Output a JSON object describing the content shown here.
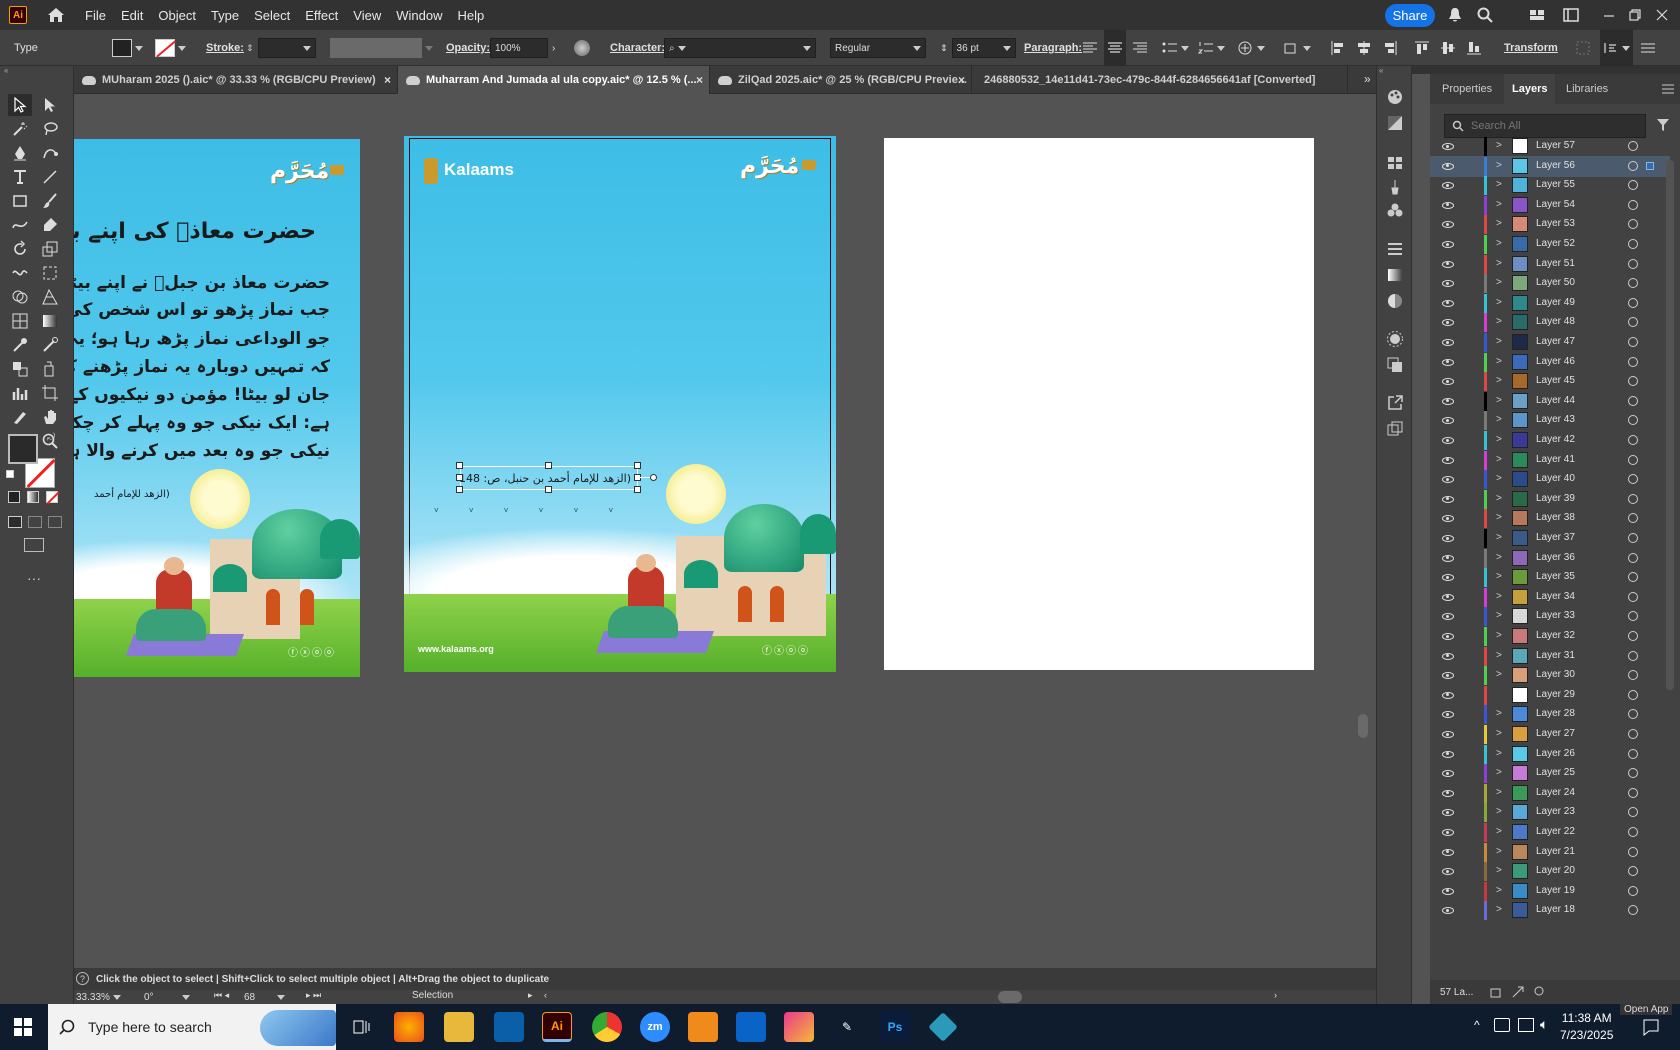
{
  "app": {
    "logo": "Ai",
    "menu": [
      "File",
      "Edit",
      "Object",
      "Type",
      "Select",
      "Effect",
      "View",
      "Window",
      "Help"
    ],
    "share": "Share"
  },
  "control": {
    "type_label": "Type",
    "stroke_label": "Stroke:",
    "opacity_label": "Opacity:",
    "opacity_value": "100%",
    "character_label": "Character:",
    "font_style": "Regular",
    "font_size": "36 pt",
    "paragraph_label": "Paragraph:",
    "transform_label": "Transform"
  },
  "tabs": [
    {
      "label": "MUharam 2025 ().aic* @ 33.33 % (RGB/CPU Preview)",
      "close": "×"
    },
    {
      "label": "Muharram And Jumada al ula copy.aic* @ 12.5 % (...",
      "close": "×"
    },
    {
      "label": "ZilQad 2025.aic* @ 25 % (RGB/CPU Previe...",
      "close": "×"
    },
    {
      "label": "246880532_14e11d41-73ec-479c-844f-6284656641af [Converted]",
      "close": ""
    }
  ],
  "artboard1": {
    "logo_urdu": "مُحَرَّم",
    "heading": "حضرت معاذؓ کی اپنے بیٹے کو",
    "body": [
      "حضرت معاذ بن جبلؓ نے اپنے بیٹے سے",
      "جب نماز پڑھو تو اس شخص کی طرح",
      "جو الوداعی نماز پڑھ رہا ہو؛ یہ ہرگز",
      "کہ تمہیں دوبارہ یہ نماز پڑھنے کا موقع",
      "جان لو بیٹا! مؤمن دو نیکیوں کے درمیان",
      "ہے: ایک نیکی جو وہ پہلے کر چکا ہے",
      "نیکی جو وہ بعد میں کرنے والا ہے"
    ],
    "reference": "(الزھد للإمام أحمد"
  },
  "artboard2": {
    "brand": "Kalaams",
    "logo_urdu": "مُحَرَّم",
    "selected_text": "(الزھد للإمام أحمد بن حنبل، ص: 148",
    "website": "www.kalaams.org"
  },
  "panel": {
    "tabs": [
      "Properties",
      "Layers",
      "Libraries"
    ],
    "search_placeholder": "Search All",
    "layers": [
      {
        "name": "Layer 57",
        "color": "#000000",
        "thumb": "#ffffff"
      },
      {
        "name": "Layer 56",
        "color": "#3a7fd6",
        "thumb": "#5bc6e8",
        "selected": true
      },
      {
        "name": "Layer 55",
        "color": "#37c3d6",
        "thumb": "#4fb3da"
      },
      {
        "name": "Layer 54",
        "color": "#8f3fd8",
        "thumb": "#8a55c7"
      },
      {
        "name": "Layer 53",
        "color": "#e04646",
        "thumb": "#d88a7a"
      },
      {
        "name": "Layer 52",
        "color": "#4fd14f",
        "thumb": "#3b6aa8"
      },
      {
        "name": "Layer 51",
        "color": "#e04646",
        "thumb": "#6c8fc4"
      },
      {
        "name": "Layer 50",
        "color": "#7a7a7a",
        "thumb": "#7fa87a"
      },
      {
        "name": "Layer 49",
        "color": "#37c3d6",
        "thumb": "#2e8a8a"
      },
      {
        "name": "Layer 48",
        "color": "#d23fd2",
        "thumb": "#2b6a6a"
      },
      {
        "name": "Layer 47",
        "color": "#3a56d6",
        "thumb": "#1f2a4a"
      },
      {
        "name": "Layer 46",
        "color": "#4fd14f",
        "thumb": "#3a6ab8"
      },
      {
        "name": "Layer 45",
        "color": "#e04646",
        "thumb": "#a8682a"
      },
      {
        "name": "Layer 44",
        "color": "#000000",
        "thumb": "#6aa0c8"
      },
      {
        "name": "Layer 43",
        "color": "#7a7a7a",
        "thumb": "#5a96c8"
      },
      {
        "name": "Layer 42",
        "color": "#37c3d6",
        "thumb": "#3a3a9a"
      },
      {
        "name": "Layer 41",
        "color": "#d23fd2",
        "thumb": "#2a8a5a"
      },
      {
        "name": "Layer 40",
        "color": "#3a56d6",
        "thumb": "#2a4a8a"
      },
      {
        "name": "Layer 39",
        "color": "#4fd14f",
        "thumb": "#2a6a4a"
      },
      {
        "name": "Layer 38",
        "color": "#e04646",
        "thumb": "#b8785a"
      },
      {
        "name": "Layer 37",
        "color": "#000000",
        "thumb": "#3a5a8a"
      },
      {
        "name": "Layer 36",
        "color": "#7a7a7a",
        "thumb": "#8a6ab8"
      },
      {
        "name": "Layer 35",
        "color": "#37c3d6",
        "thumb": "#6a9a3a"
      },
      {
        "name": "Layer 34",
        "color": "#d23fd2",
        "thumb": "#c8a03a"
      },
      {
        "name": "Layer 33",
        "color": "#3a56d6",
        "thumb": "#d8d8d8"
      },
      {
        "name": "Layer 32",
        "color": "#4fd14f",
        "thumb": "#c87a7a"
      },
      {
        "name": "Layer 31",
        "color": "#e04646",
        "thumb": "#5aa8b8"
      },
      {
        "name": "Layer 30",
        "color": "#4fd14f",
        "thumb": "#d8a07a"
      },
      {
        "name": "Layer 29",
        "color": "#e04646",
        "thumb": "#ffffff",
        "nochev": true
      },
      {
        "name": "Layer 28",
        "color": "#3a56d6",
        "thumb": "#4a8ad8"
      },
      {
        "name": "Layer 27",
        "color": "#e8c83a",
        "thumb": "#d8a03a"
      },
      {
        "name": "Layer 26",
        "color": "#37c3d6",
        "thumb": "#5ac8e8"
      },
      {
        "name": "Layer 25",
        "color": "#8f3fd8",
        "thumb": "#c87ad8"
      },
      {
        "name": "Layer 24",
        "color": "#a8a83a",
        "thumb": "#3a9a5a"
      },
      {
        "name": "Layer 23",
        "color": "#8aa83a",
        "thumb": "#5aa8d8"
      },
      {
        "name": "Layer 22",
        "color": "#c83a5a",
        "thumb": "#4a7ac8"
      },
      {
        "name": "Layer 21",
        "color": "#c88a3a",
        "thumb": "#b8885a"
      },
      {
        "name": "Layer 20",
        "color": "#8a6a3a",
        "thumb": "#3a9a7a"
      },
      {
        "name": "Layer 19",
        "color": "#c83a3a",
        "thumb": "#3a8ac8"
      },
      {
        "name": "Layer 18",
        "color": "#6a6ad8",
        "thumb": "#3a5a9a"
      }
    ],
    "footer": "57 La..."
  },
  "status": {
    "hint": "Click the object to select  |  Shift+Click to select multiple object  |  Alt+Drag the object to duplicate",
    "zoom": "33.33%",
    "rotation": "0°",
    "artboard_num": "68",
    "tool": "Selection"
  },
  "taskbar": {
    "search_placeholder": "Type here to search",
    "time": "11:38 AM",
    "date": "7/23/2025",
    "open_app": "Open App"
  }
}
